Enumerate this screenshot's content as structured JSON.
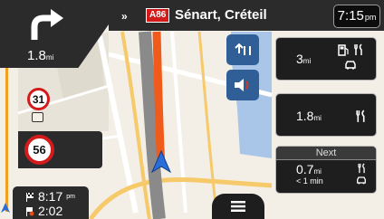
{
  "maneuver": {
    "distance": "1.8",
    "unit": "mi",
    "icon": "turn-right-then-left-icon"
  },
  "topbar": {
    "arrow": "»",
    "road_badge": "A86",
    "street": "Sénart, Créteil",
    "time": "7:15",
    "time_suffix": "pm"
  },
  "speed": {
    "limit_small": "31",
    "limit": "56",
    "camera_icon": "speed-camera-icon"
  },
  "side_buttons": [
    {
      "icon": "lane-guidance-icon"
    },
    {
      "icon": "speaker-sound-icon"
    }
  ],
  "panels": [
    {
      "distance": "3",
      "unit": "mi",
      "icons": [
        "fuel-pump-icon",
        "restaurant-icon",
        "car-service-icon"
      ]
    },
    {
      "distance": "1.8",
      "unit": "mi",
      "icons": [
        "restaurant-icon"
      ]
    },
    {
      "label": "Next",
      "distance": "0.7",
      "unit": "mi",
      "duration": "< 1 min",
      "icons": [
        "restaurant-icon",
        "car-service-icon"
      ]
    }
  ],
  "eta": {
    "arrival_time": "8:17",
    "arrival_suffix": "pm",
    "remaining_time": "2:02",
    "arrival_icon": "checkered-flag-icon",
    "remaining_icon": "clock-flag-icon"
  },
  "menu": {
    "icon": "hamburger-menu-icon"
  },
  "colors": {
    "panel": "#2b2b2b",
    "accent_blue": "#2f5f96",
    "route_orange": "#f05a1a",
    "speed_red": "#d41b1b",
    "road_yellow": "#f6c96a"
  }
}
